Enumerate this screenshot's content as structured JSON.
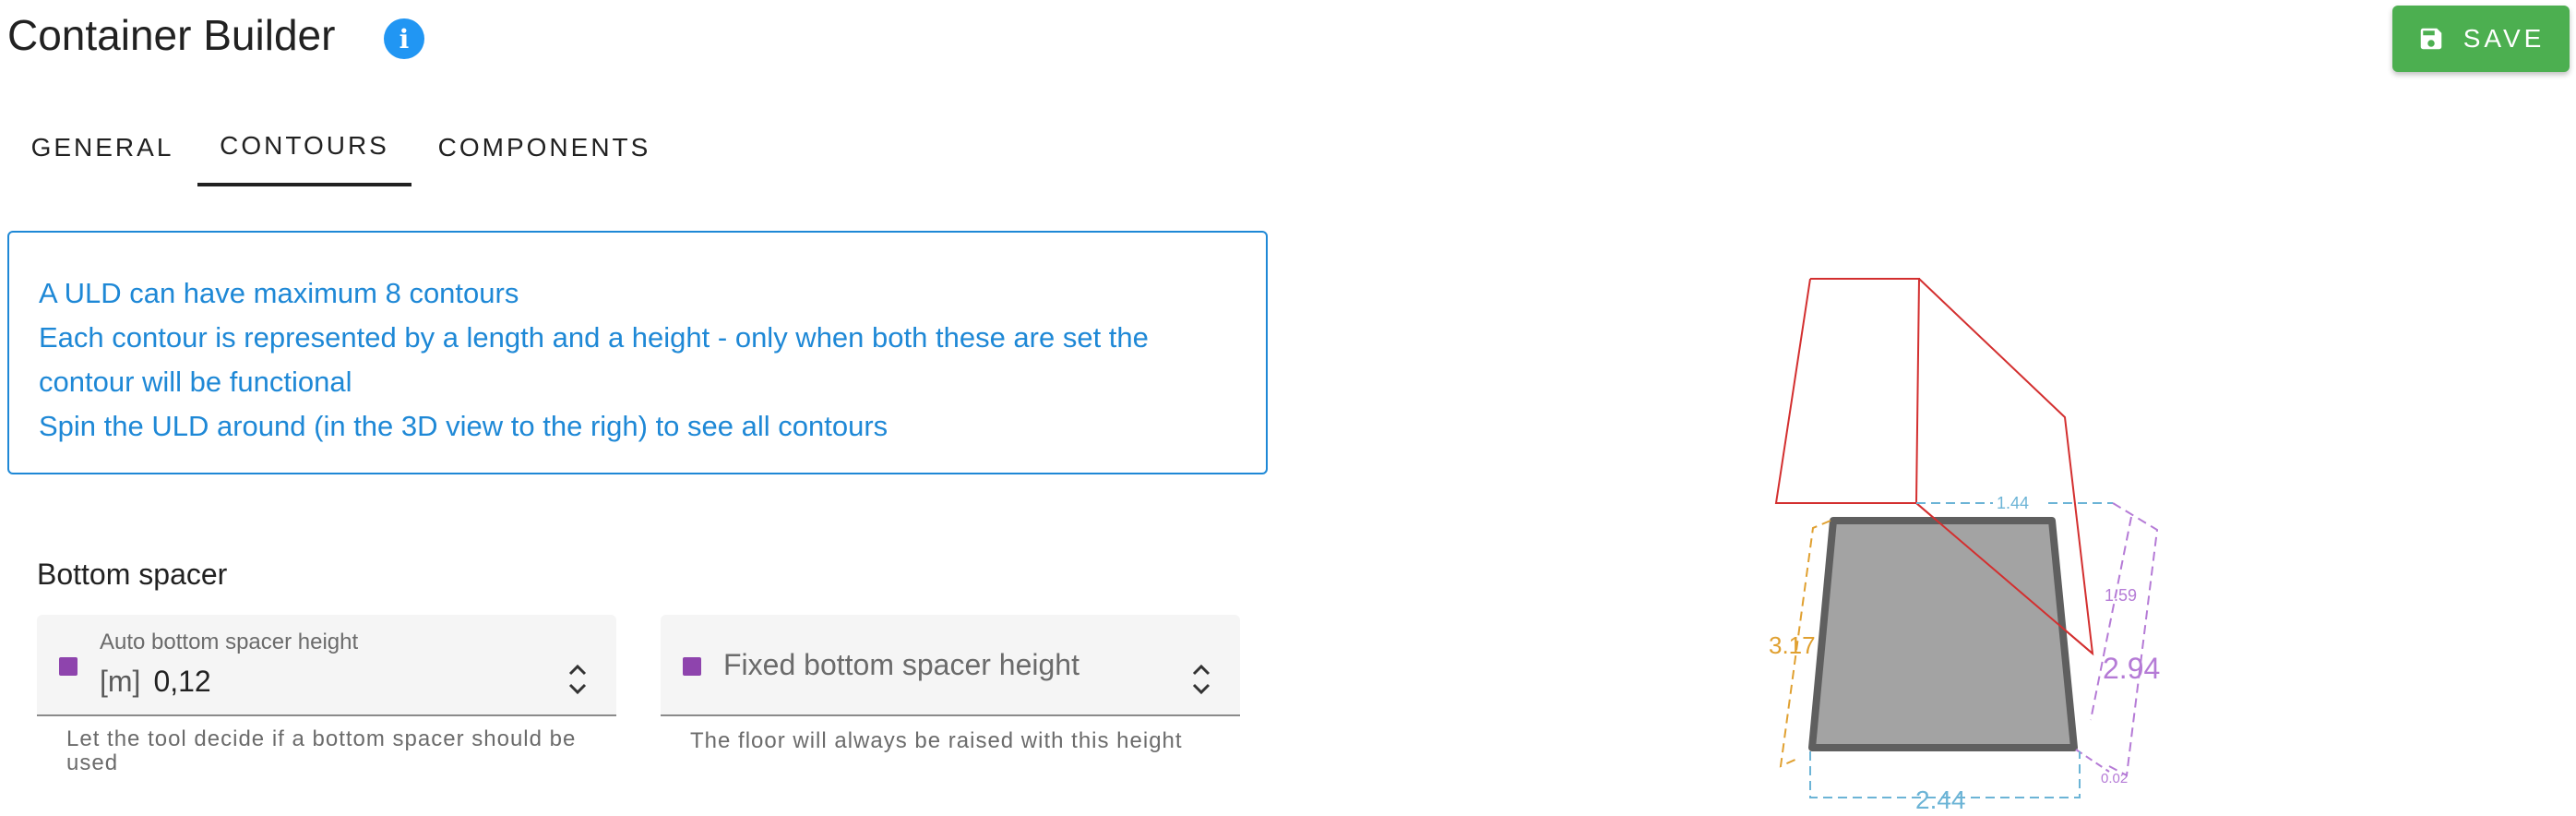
{
  "header": {
    "title": "Container Builder",
    "info_icon": "info-icon",
    "save_label": "SAVE",
    "save_icon": "floppy-disk-icon"
  },
  "tabs": [
    {
      "label": "GENERAL",
      "active": false
    },
    {
      "label": "CONTOURS",
      "active": true
    },
    {
      "label": "COMPONENTS",
      "active": false
    }
  ],
  "info": {
    "lines": [
      "A ULD can have maximum 8 contours",
      "Each contour is represented by a length and a height - only when both these are set the",
      "contour will be functional",
      "Spin the ULD around (in the 3D view to the righ) to see all contours"
    ]
  },
  "bottom_spacer": {
    "title": "Bottom spacer",
    "auto": {
      "label": "Auto bottom spacer height",
      "unit": "[m]",
      "value": "0,12",
      "helper": "Let the tool decide if a bottom spacer should be used"
    },
    "fixed": {
      "placeholder": "Fixed bottom spacer height",
      "helper": "The floor will always be raised with this height"
    }
  },
  "viewer": {
    "dimensions": {
      "top_width": "1.44",
      "left_height": "3.17",
      "right_depth_small": "1.59",
      "right_height": "2.94",
      "bottom_offset": "0.02",
      "bottom_width": "2.44"
    },
    "colors": {
      "contour": "#d32f2f",
      "cyan": "#6cb4d6",
      "orange": "#e0a030",
      "purple": "#b57bd6",
      "body": "#a3a3a3",
      "edge": "#5f5f5f"
    }
  },
  "colors": {
    "accent": "#1e88d6",
    "save": "#4caf50",
    "checkbox": "#8e44ad"
  }
}
